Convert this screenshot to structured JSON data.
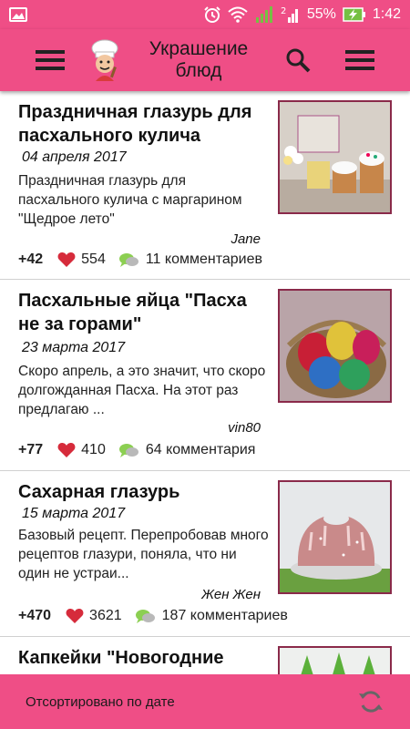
{
  "status_bar": {
    "battery": "55%",
    "time": "1:42",
    "icons": [
      "image-icon",
      "alarm-icon",
      "wifi-icon",
      "signal-icon",
      "signal-2-icon",
      "battery-charging-icon"
    ]
  },
  "app_bar": {
    "title": "Украшение блюд",
    "icons": [
      "hamburger-menu-icon",
      "chef-logo-icon",
      "search-icon",
      "overflow-menu-icon"
    ]
  },
  "recipes": [
    {
      "title": "Праздничная глазурь для пасхального кулича",
      "date": "04 апреля 2017",
      "description": "Праздничная глазурь для пасхального кулича с маргарином \"Щедрое лето\"",
      "author": "Jane",
      "rating": "+42",
      "likes": "554",
      "comments": "11 комментариев"
    },
    {
      "title": "Пасхальные яйца \"Пасха не за горами\"",
      "date": "23 марта 2017",
      "description": "Скоро апрель, а это значит, что скоро долгожданная Пасха. На этот раз предлагаю ...",
      "author": "vin80",
      "rating": "+77",
      "likes": "410",
      "comments": "64 комментария"
    },
    {
      "title": "Сахарная глазурь",
      "date": "15 марта 2017",
      "description": "Базовый рецепт. Перепробовав много рецептов глазури, поняла, что ни один не устраи...",
      "author": "Жен Жен",
      "rating": "+470",
      "likes": "3621",
      "comments": "187 комментариев"
    },
    {
      "title": "Капкейки \"Новогодние"
    }
  ],
  "bottom_bar": {
    "sort_label": "Отсортировано по дате",
    "refresh_icon": "refresh-icon"
  },
  "colors": {
    "accent": "#ef4e86",
    "thumb_border": "#8a2a4a",
    "heart": "#d62b3b",
    "divider": "#d0d0d0"
  }
}
